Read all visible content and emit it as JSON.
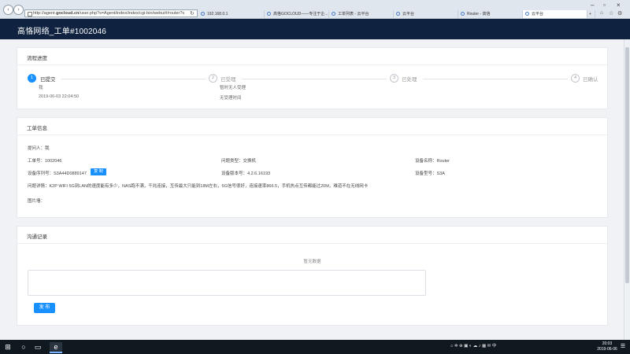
{
  "browser": {
    "url_prefix": "http://agent.",
    "url_domain": "gocloud.cn",
    "url_rest": "/user.php?s=Agent/index/index/cgi-bin/webui#/router?s",
    "tabs": [
      {
        "label": "192.168.0.1"
      },
      {
        "label": "高恪GOCLOUD——专注于企..."
      },
      {
        "label": "工单列表 - 云平台"
      },
      {
        "label": "云平台"
      },
      {
        "label": "Router - 高恪"
      },
      {
        "label": "云平台"
      }
    ]
  },
  "app": {
    "title": "高恪网络_工单#1002046"
  },
  "progress": {
    "title": "流程进度",
    "steps": [
      {
        "num": "1",
        "label": "已提交",
        "sub1": "我",
        "sub2": "2019-06-03 22:04:50",
        "done": true
      },
      {
        "num": "2",
        "label": "已受理",
        "sub1": "暂时无人受理",
        "sub2": "无受理时间",
        "done": false
      },
      {
        "num": "3",
        "label": "已处理",
        "done": false
      },
      {
        "num": "4",
        "label": "已确认",
        "done": false
      }
    ]
  },
  "info": {
    "title": "工单信息",
    "submitter": "提问人：我",
    "ticket_no": "工单号：1002046",
    "problem_type": "问题类型：交换机",
    "device_name": "设备名称：Router",
    "serial": "设备序列号：S3A44D0889147",
    "copy_label": "复 制",
    "version": "设备版本号：4.2.6.16193",
    "model": "设备型号：S3A",
    "detail": "问题详情：K2P WIFI 5G到LAN的速度能有多少，NAS跑不满，千兆连接，互传最大只能到18M左右，5G信号很好，连接速率866.5，手机热点互传都能过20M，难道不在无线网卡",
    "images": "图片墙："
  },
  "comm": {
    "title": "沟通记录",
    "empty": "暂无数据",
    "submit_label": "发 布"
  },
  "taskbar": {
    "time": "20:03",
    "date": "2019-06-06"
  },
  "colors": {
    "appbar": "#0f2340",
    "accent": "#1890ff"
  }
}
